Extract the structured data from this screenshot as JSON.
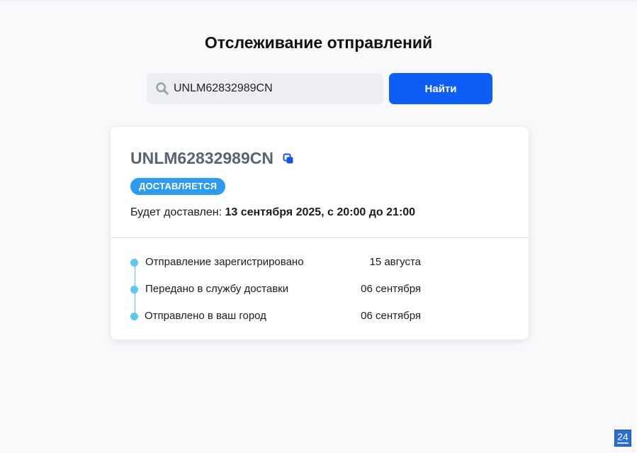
{
  "page": {
    "title": "Отслеживание отправлений"
  },
  "search": {
    "value": "UNLM62832989CN",
    "button_label": "Найти"
  },
  "card": {
    "tracking_number": "UNLM62832989CN",
    "status": "ДОСТАВЛЯЕТСЯ",
    "delivery_label": "Будет доставлен: ",
    "delivery_value": "13 сентября 2025, с 20:00 до 21:00",
    "events": [
      {
        "label": "Отправление зарегистрировано",
        "date": "15 августа"
      },
      {
        "label": "Передано в службу доставки",
        "date": "06 сентября"
      },
      {
        "label": "Отправлено в ваш город",
        "date": "06 сентября"
      }
    ]
  },
  "corner_badge": {
    "text": "24"
  },
  "colors": {
    "primary": "#0d5ef7",
    "status_badge": "#2d9cf0",
    "timeline": "#5bc8f5",
    "background": "#f8f9fb"
  },
  "icons": {
    "search": "search-icon",
    "copy": "copy-icon"
  }
}
